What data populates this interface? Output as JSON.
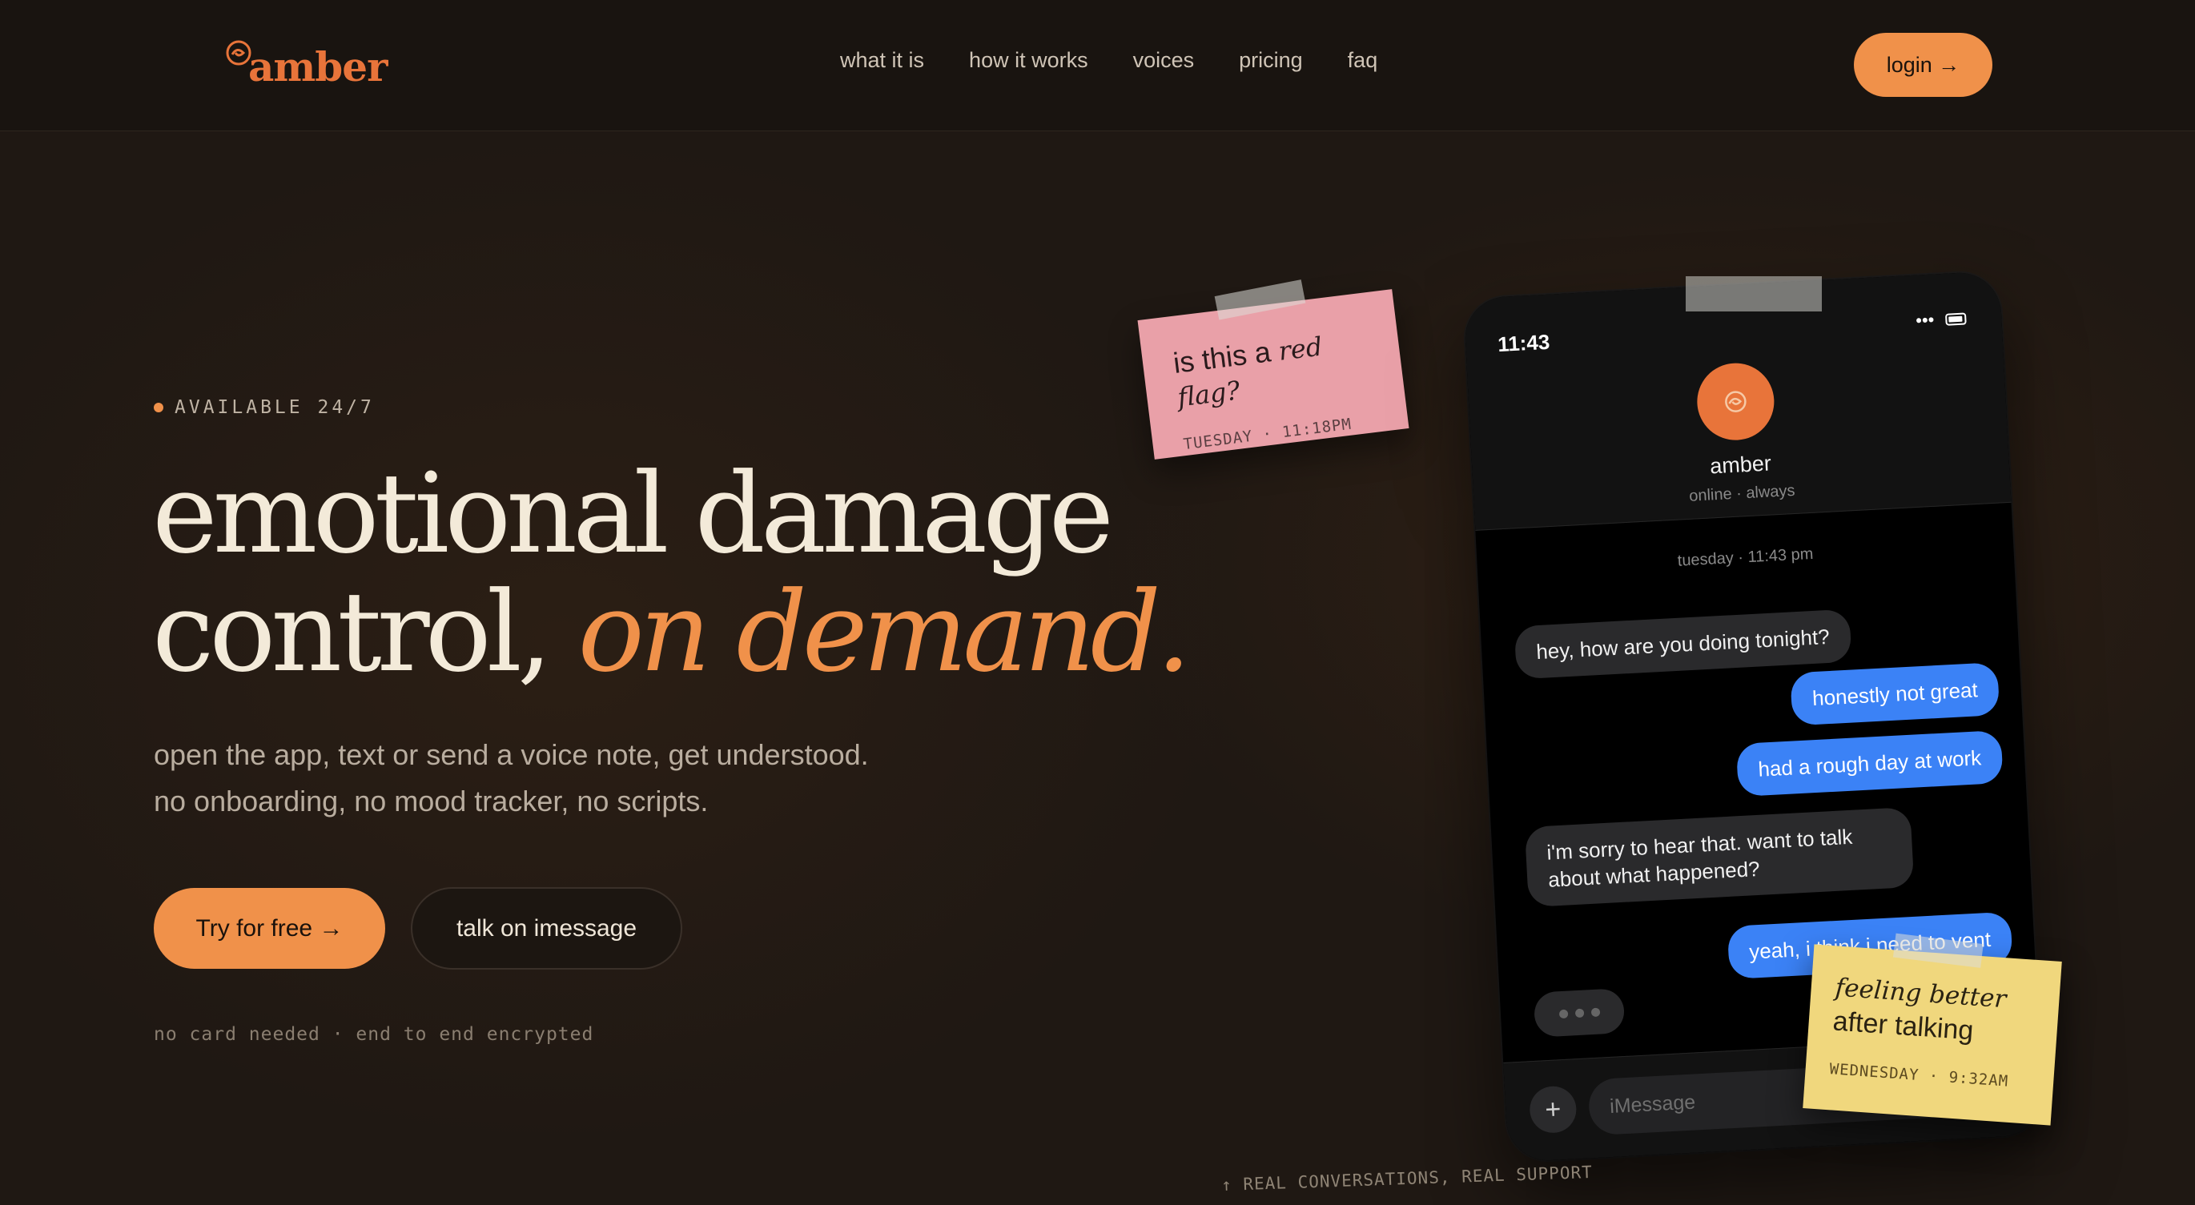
{
  "brand": {
    "name": "amber",
    "accent": "#f0914a",
    "logo_color": "#e8743a"
  },
  "nav": {
    "links": [
      "what it is",
      "how it works",
      "voices",
      "pricing",
      "faq"
    ],
    "login_label": "login →"
  },
  "hero": {
    "badge": "AVAILABLE 24/7",
    "headline_line1": "emotional damage",
    "headline_line2": "control,",
    "headline_accent": "on demand.",
    "sub_line1": "open the app, text or send a voice note, get understood.",
    "sub_line2": "no onboarding, no mood tracker, no scripts.",
    "cta_primary": "Try for free →",
    "cta_secondary": "talk on imessage",
    "fineprint": "no card needed · end to end encrypted"
  },
  "notes": {
    "pink": {
      "text_plain": "is this a",
      "text_italic": "red flag?",
      "meta": "TUESDAY · 11:18PM",
      "color": "#e9a0a8"
    },
    "yellow": {
      "text_italic": "feeling better",
      "text_plain": "after talking",
      "meta": "WEDNESDAY · 9:32AM",
      "color": "#f0d77d"
    }
  },
  "phone": {
    "time": "11:43",
    "contact_name": "amber",
    "contact_status": "online · always",
    "thread_time": "tuesday · 11:43 pm",
    "messages": [
      {
        "from": "amber",
        "text": "hey, how are you doing tonight?"
      },
      {
        "from": "user",
        "text": "honestly not great"
      },
      {
        "from": "user",
        "text": "had a rough day at work"
      },
      {
        "from": "amber",
        "text": "i'm sorry to hear that. want to talk about what happened?"
      },
      {
        "from": "user",
        "text": "yeah, i think i need to vent"
      }
    ],
    "input_placeholder": "iMessage",
    "plus_label": "+"
  },
  "caption": "↑ REAL CONVERSATIONS, REAL SUPPORT",
  "icons": {
    "logo": "amber-swirl-icon",
    "more": "ellipsis-icon",
    "battery": "battery-icon",
    "avatar": "amber-swirl-icon",
    "typing": "typing-indicator-icon"
  }
}
